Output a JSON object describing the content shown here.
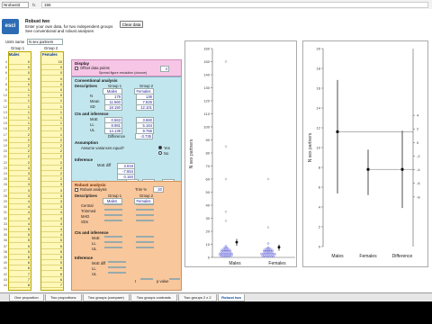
{
  "formula_bar": {
    "cell_ref": "Nrobust3",
    "fx": "fx",
    "formula": "155"
  },
  "header": {
    "logo": "esci",
    "title": "Robust two",
    "instructions": [
      "Enter your own data, for two independent groups",
      "See conventional and robust analyses"
    ],
    "clear_button": "Clear data",
    "units_label": "Units name",
    "units_value": "N sex partners",
    "group_labels": [
      "Group 1",
      "Group 2"
    ],
    "group1_name": "Males",
    "group2_name": "Females"
  },
  "data": {
    "row_numbers": [
      "4",
      "5",
      "6",
      "7",
      "8",
      "9",
      "10",
      "11",
      "12",
      "13",
      "14",
      "15",
      "16",
      "17",
      "18",
      "19",
      "20",
      "21",
      "22",
      "23",
      "24",
      "25",
      "26",
      "27",
      "28",
      "29",
      "30",
      "31",
      "32",
      "33",
      "34",
      "35",
      "36",
      "37",
      "38",
      "39",
      "40",
      "41",
      "42",
      "43",
      "44"
    ],
    "males": [
      "0",
      "0",
      "0",
      "0",
      "0",
      "1",
      "1",
      "1",
      "1",
      "1",
      "1",
      "1",
      "2",
      "2",
      "2",
      "2",
      "2",
      "2",
      "2",
      "3",
      "3",
      "3",
      "3",
      "3",
      "3",
      "4",
      "4",
      "4",
      "4",
      "4",
      "5",
      "5",
      "5",
      "5",
      "5",
      "6",
      "6",
      "6",
      "7",
      "7",
      "8"
    ],
    "females": [
      "10",
      "0",
      "0",
      "0",
      "0",
      "0",
      "0",
      "1",
      "1",
      "1",
      "1",
      "1",
      "1",
      "1",
      "2",
      "2",
      "2",
      "2",
      "2",
      "2",
      "2",
      "2",
      "3",
      "3",
      "3",
      "3",
      "3",
      "4",
      "4",
      "4",
      "4",
      "4",
      "5",
      "5",
      "5",
      "5",
      "5",
      "6",
      "6",
      "6",
      "7"
    ]
  },
  "panels": {
    "display": {
      "label": "Display",
      "option": "Offset data points",
      "value": "4",
      "note": "Spread figure resolution (choose)"
    },
    "conventional": {
      "label": "Conventional analysis",
      "descriptives": "Descriptives",
      "rows": [
        {
          "name": "N",
          "g1": "179",
          "g2": "136"
        },
        {
          "name": "Mean",
          "g1": "11.560",
          "g2": "7.825"
        },
        {
          "name": "SD",
          "g1": "18.150",
          "g2": "12.101"
        }
      ]
    },
    "cis": {
      "label": "CIs and inference",
      "rows": [
        {
          "name": "MoE",
          "g1": "0.563",
          "g2": "3.660"
        },
        {
          "name": "LL",
          "g1": "8.981",
          "g2": "5.164"
        },
        {
          "name": "UL",
          "g1": "14.139",
          "g2": "9.766"
        }
      ],
      "diff_label": "Difference",
      "diff_value": "-3.735"
    },
    "assumption": {
      "label": "Assumption",
      "question": "Assume variances equal?",
      "yes": "Yes",
      "no": "No"
    },
    "inference": {
      "label": "Inference",
      "rows": [
        {
          "name": "MoE diff",
          "value": "3.919"
        },
        {
          "name": "",
          "value": "-7.654"
        },
        {
          "name": "",
          "value": "0.184"
        }
      ],
      "t_label": "Independent groups t",
      "t_value": "2.06",
      "df": "313",
      "p_label": "p",
      "p_value": ".040"
    },
    "robust": {
      "label": "Robust analysis",
      "option": "Robust analysis",
      "trim_label": "Trim %",
      "trim_value": "20",
      "descriptives": "Descriptives",
      "rows": [
        "Central",
        "Trimmed",
        "MAD",
        "SDs"
      ],
      "cis_label": "CIs and inference",
      "cis_rows": [
        "MoE",
        "LL",
        "UL"
      ],
      "inference_label": "Inference",
      "inf_rows": [
        "MoE diff",
        "LL",
        "UL"
      ],
      "t_label": "t",
      "p_label": "p value"
    }
  },
  "chart1": {
    "ylabel": "N sex partners",
    "categories": [
      "Males",
      "Females"
    ],
    "yticks": [
      "0",
      "10",
      "20",
      "30",
      "40",
      "50",
      "60",
      "70",
      "80",
      "90",
      "100",
      "110",
      "120",
      "130",
      "140",
      "150",
      "160"
    ]
  },
  "chart2": {
    "ylabel": "N sex partners",
    "categories": [
      "Males",
      "Females",
      "Difference"
    ],
    "yticks_left": [
      "0",
      "2",
      "4",
      "6",
      "8",
      "10",
      "12",
      "14",
      "16",
      "18",
      "20"
    ],
    "yticks_right": [
      "-8",
      "-6",
      "-4",
      "-2",
      "0",
      "2",
      "4"
    ],
    "chart_data": {
      "type": "scatter",
      "categories": [
        "Males",
        "Females",
        "Difference"
      ],
      "means": [
        11.6,
        7.8,
        7.8
      ],
      "ll": [
        9.0,
        5.2,
        3.9
      ],
      "ul": [
        14.1,
        9.8,
        11.7
      ]
    }
  },
  "tabs": [
    "One proportion",
    "Two proportions",
    "Two groups (compare)",
    "Two groups contrasts",
    "Two groups 2 x 2",
    "Robust two"
  ]
}
